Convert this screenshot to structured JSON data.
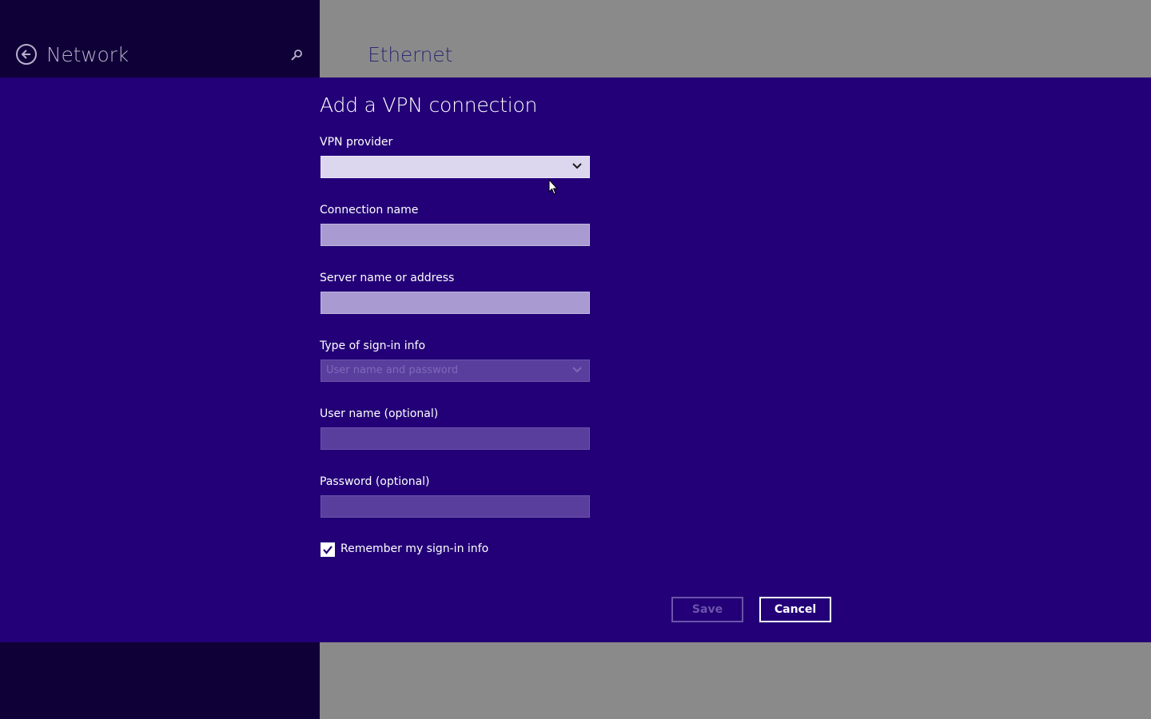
{
  "header": {
    "back_icon": "back-arrow-icon",
    "title": "Network",
    "search_icon": "search-icon",
    "content_title": "Ethernet"
  },
  "dialog": {
    "title": "Add a VPN connection",
    "vpn_provider": {
      "label": "VPN provider",
      "value": ""
    },
    "connection_name": {
      "label": "Connection name",
      "value": ""
    },
    "server": {
      "label": "Server name or address",
      "value": ""
    },
    "sign_in_type": {
      "label": "Type of sign-in info",
      "value": "User name and password",
      "disabled": true
    },
    "username": {
      "label": "User name (optional)",
      "value": "",
      "disabled": true
    },
    "password": {
      "label": "Password (optional)",
      "value": "",
      "disabled": true
    },
    "remember": {
      "label": "Remember my sign-in info",
      "checked": true
    },
    "save_label": "Save",
    "cancel_label": "Cancel"
  },
  "colors": {
    "dialog_bg": "#230077",
    "left_pane_bg": "#0f0037",
    "right_pane_bg": "#8a8a8a"
  }
}
